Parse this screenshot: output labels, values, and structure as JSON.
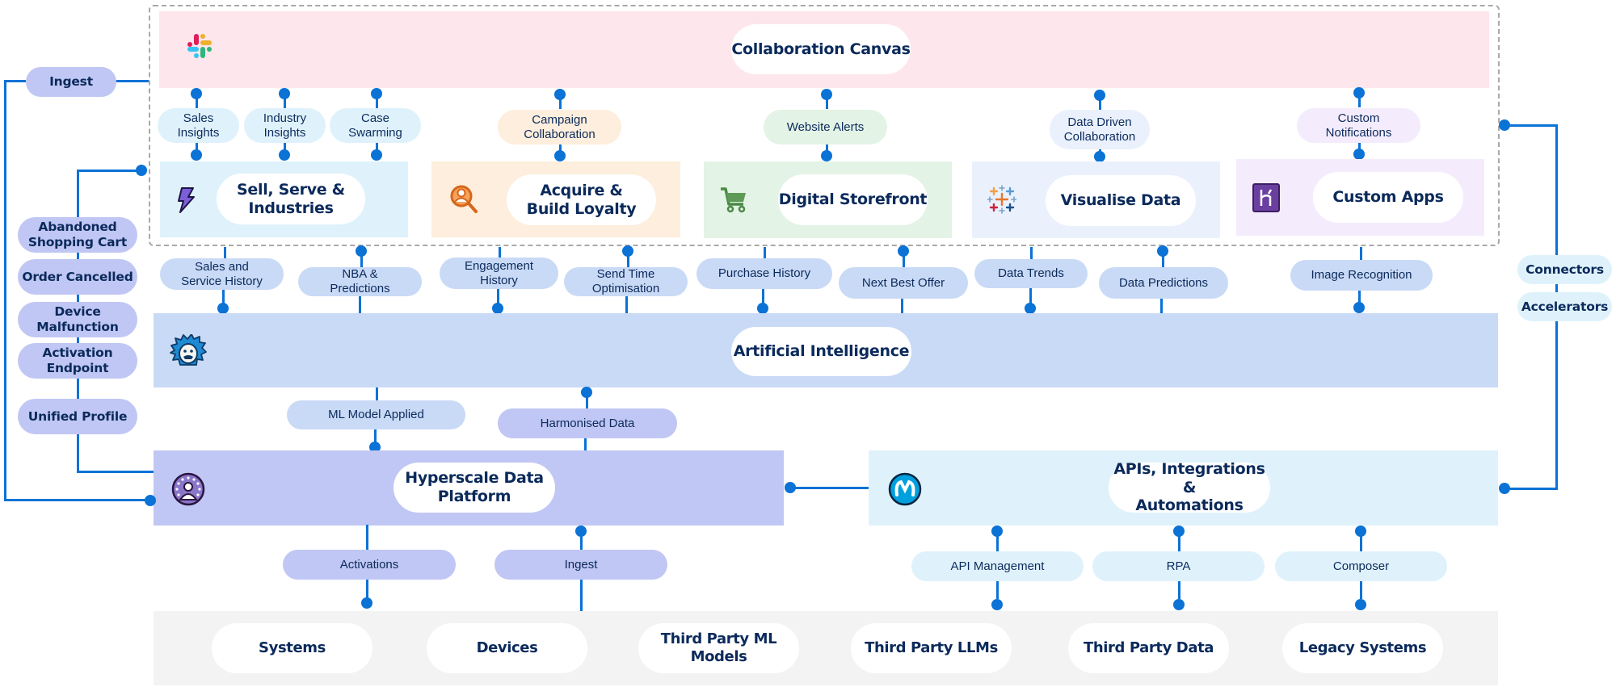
{
  "colors": {
    "connector": "#0b72d6",
    "text": "#0b2a5b",
    "collaboration_band": "#fde6ec",
    "sell_band": "#dff2fc",
    "acquire_band": "#fdeedd",
    "digital_band": "#e3f3e5",
    "visualise_band": "#eaf1fd",
    "custom_apps_band": "#f4ecfd",
    "ai_band": "#c9daf6",
    "data_platform_band": "#c0c7f4",
    "api_band": "#dff2fc",
    "sources_band": "#f3f3f3",
    "dashed_border": "#a9a9a9"
  },
  "collaboration": {
    "title": "Collaboration Canvas",
    "icon": "slack-icon",
    "channels": [
      {
        "label": "Sales\nInsights"
      },
      {
        "label": "Industry\nInsights"
      },
      {
        "label": "Case\nSwarming"
      },
      {
        "label": "Campaign\nCollaboration"
      },
      {
        "label": "Website Alerts"
      },
      {
        "label": "Data Driven\nCollaboration"
      },
      {
        "label": "Custom\nNotifications"
      }
    ]
  },
  "apps": [
    {
      "title": "Sell, Serve &\nIndustries",
      "icon": "lightning-bolt-icon"
    },
    {
      "title": "Acquire &\nBuild Loyalty",
      "icon": "person-search-icon"
    },
    {
      "title": "Digital Storefront",
      "icon": "shopping-cart-icon"
    },
    {
      "title": "Visualise Data",
      "icon": "tableau-cross-icon"
    },
    {
      "title": "Custom Apps",
      "icon": "heroku-icon"
    }
  ],
  "app_to_ai_flows": [
    {
      "label": "Sales and\nService History"
    },
    {
      "label": "NBA &\nPredictions"
    },
    {
      "label": "Engagement\nHistory"
    },
    {
      "label": "Send Time\nOptimisation"
    },
    {
      "label": "Purchase History"
    },
    {
      "label": "Next Best Offer"
    },
    {
      "label": "Data Trends"
    },
    {
      "label": "Data Predictions"
    },
    {
      "label": "Image Recognition"
    }
  ],
  "ai": {
    "title": "Artificial Intelligence",
    "icon": "einstein-icon"
  },
  "ai_to_data_flows": [
    {
      "label": "ML Model Applied"
    },
    {
      "label": "Harmonised Data"
    }
  ],
  "data_platform": {
    "title": "Hyperscale Data\nPlatform",
    "icon": "data-cloud-person-icon"
  },
  "integration": {
    "title": "APIs, Integrations &\nAutomations",
    "icon": "mulesoft-icon"
  },
  "left_flow": {
    "ingest": "Ingest",
    "events": [
      {
        "label": "Abandoned\nShopping Cart"
      },
      {
        "label": "Order Cancelled"
      },
      {
        "label": "Device\nMalfunction"
      },
      {
        "label": "Activation\nEndpoint"
      },
      {
        "label": "Unified Profile"
      }
    ]
  },
  "right_flow": {
    "items": [
      {
        "label": "Connectors"
      },
      {
        "label": "Accelerators"
      }
    ]
  },
  "data_platform_flows": [
    {
      "label": "Activations"
    },
    {
      "label": "Ingest"
    }
  ],
  "integration_flows": [
    {
      "label": "API Management"
    },
    {
      "label": "RPA"
    },
    {
      "label": "Composer"
    }
  ],
  "sources": [
    {
      "label": "Systems"
    },
    {
      "label": "Devices"
    },
    {
      "label": "Third Party ML\nModels"
    },
    {
      "label": "Third Party LLMs"
    },
    {
      "label": "Third Party Data"
    },
    {
      "label": "Legacy Systems"
    }
  ]
}
